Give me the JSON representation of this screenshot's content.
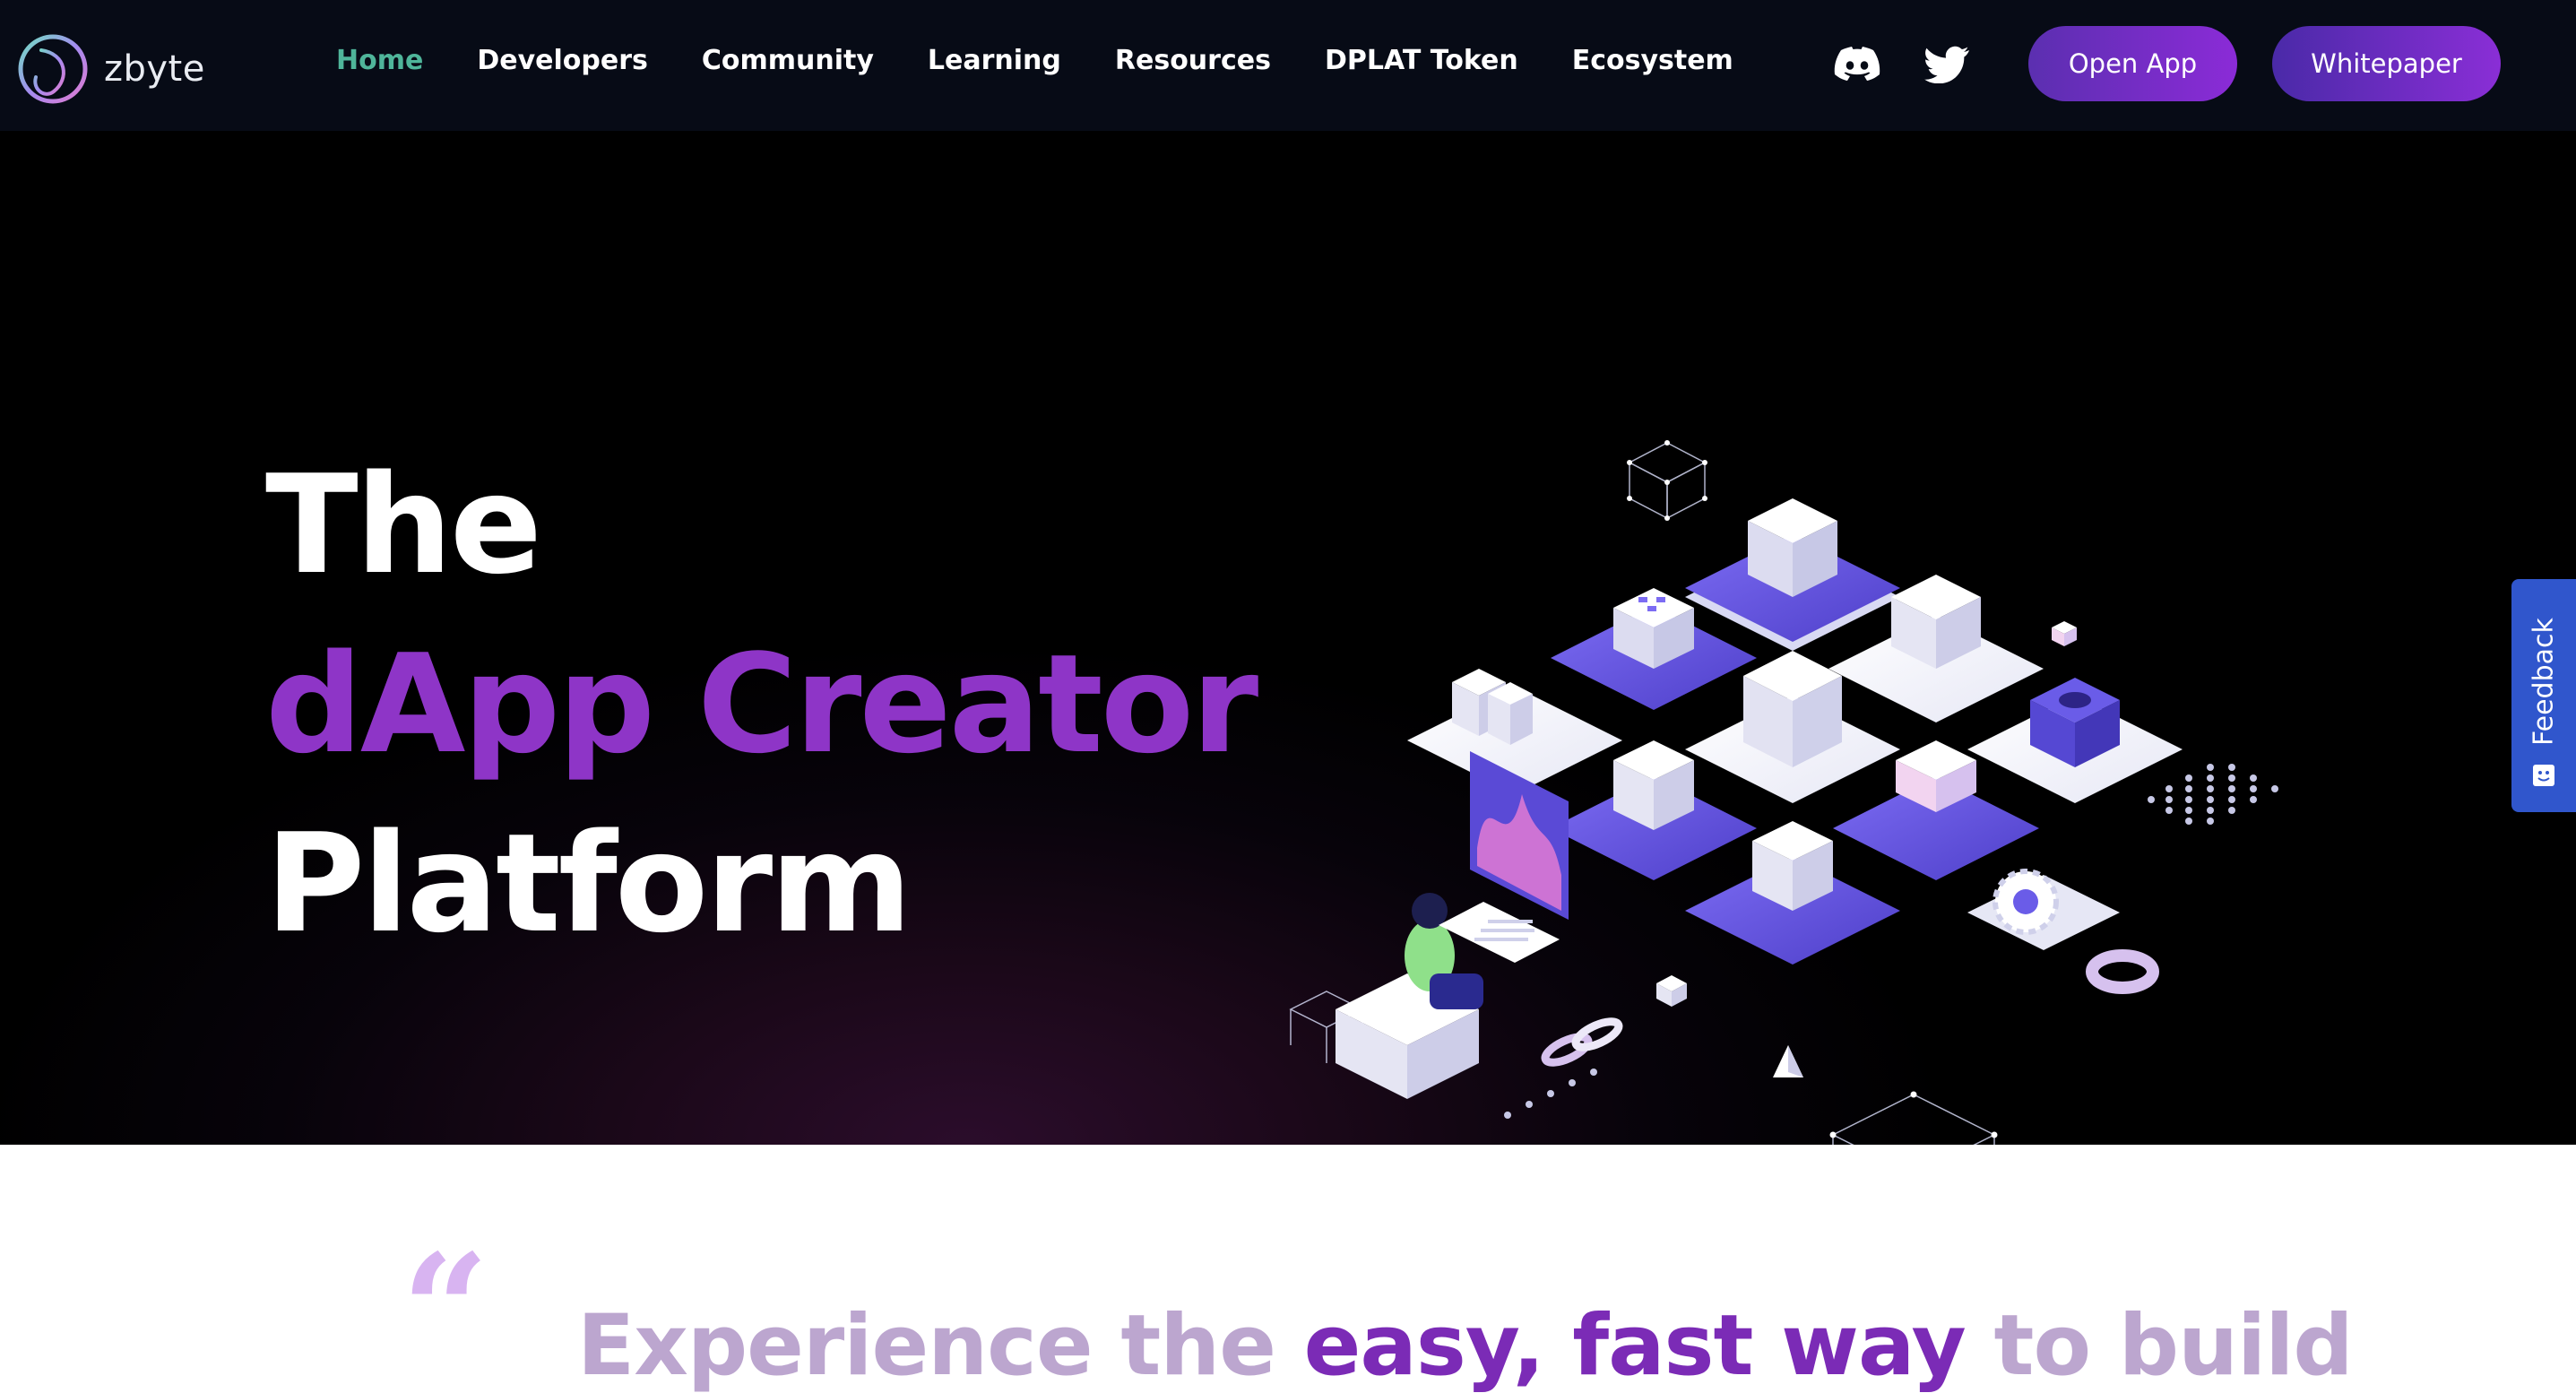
{
  "brand": {
    "name": "zbyte"
  },
  "nav": {
    "links": [
      {
        "label": "Home",
        "active": true
      },
      {
        "label": "Developers",
        "active": false
      },
      {
        "label": "Community",
        "active": false
      },
      {
        "label": "Learning",
        "active": false
      },
      {
        "label": "Resources",
        "active": false
      },
      {
        "label": "DPLAT Token",
        "active": false
      },
      {
        "label": "Ecosystem",
        "active": false
      }
    ],
    "social_icons": [
      "discord-icon",
      "twitter-icon"
    ],
    "buttons": {
      "open_app": "Open App",
      "whitepaper": "Whitepaper"
    }
  },
  "hero": {
    "line1": "The",
    "line2": "dApp Creator",
    "line3": "Platform"
  },
  "feedback": {
    "label": "Feedback"
  },
  "tagline": {
    "part1": "Experience the ",
    "part2": "easy, fast way",
    "part3": " to build"
  },
  "colors": {
    "nav_bg": "#070b16",
    "active_link": "#4fb59a",
    "accent_purple": "#8e35c7",
    "feedback_blue": "#3056cc",
    "tagline_muted": "#bca6cf",
    "tagline_strong": "#7b2bb6"
  }
}
